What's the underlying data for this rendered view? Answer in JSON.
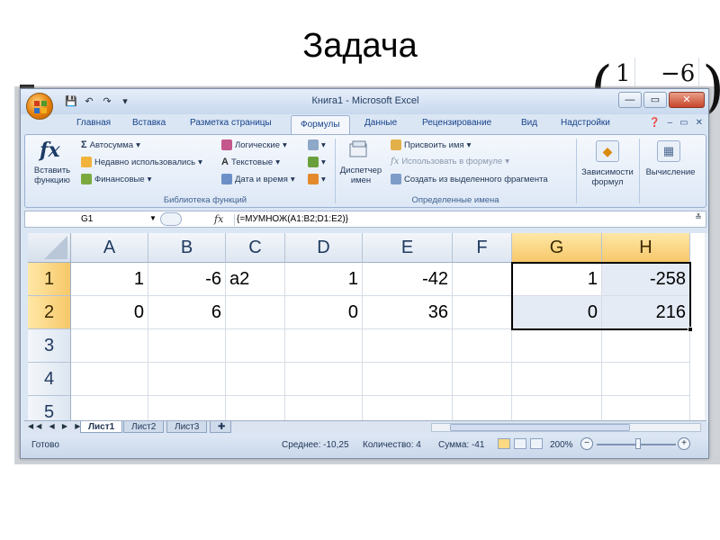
{
  "slide": {
    "title": "Задача",
    "matrix_row1": [
      "1",
      "−6"
    ]
  },
  "window": {
    "title": "Книга1 - Microsoft Excel"
  },
  "tabs": [
    "Главная",
    "Вставка",
    "Разметка страницы",
    "Формулы",
    "Данные",
    "Рецензирование",
    "Вид",
    "Надстройки"
  ],
  "ribbon": {
    "insert_function": "Вставить функцию",
    "autosum": "Автосумма",
    "recent": "Недавно использовались",
    "financial": "Финансовые",
    "logical": "Логические",
    "text": "Текстовые",
    "datetime": "Дата и время",
    "group_library": "Библиотека функций",
    "name_manager": "Диспетчер имен",
    "assign_name": "Присвоить имя",
    "use_in_formula": "Использовать в формуле",
    "create_from_selection": "Создать из выделенного фрагмента",
    "group_names": "Определенные имена",
    "dependencies": "Зависимости формул",
    "calculation": "Вычисление"
  },
  "formula_bar": {
    "name_box": "G1",
    "formula": "{=МУМНОЖ(A1:B2;D1:E2)}"
  },
  "columns": [
    "A",
    "B",
    "C",
    "D",
    "E",
    "F",
    "G",
    "H"
  ],
  "rows": [
    "1",
    "2",
    "3",
    "4",
    "5"
  ],
  "cells": {
    "A1": "1",
    "B1": "-6",
    "C1": "a2",
    "D1": "1",
    "E1": "-42",
    "G1": "1",
    "H1": "-258",
    "A2": "0",
    "B2": "6",
    "D2": "0",
    "E2": "36",
    "G2": "0",
    "H2": "216"
  },
  "sheets": [
    "Лист1",
    "Лист2",
    "Лист3"
  ],
  "status": {
    "ready": "Готово",
    "average": "Среднее: -10,25",
    "count": "Количество: 4",
    "sum": "Сумма: -41",
    "zoom": "200%"
  }
}
